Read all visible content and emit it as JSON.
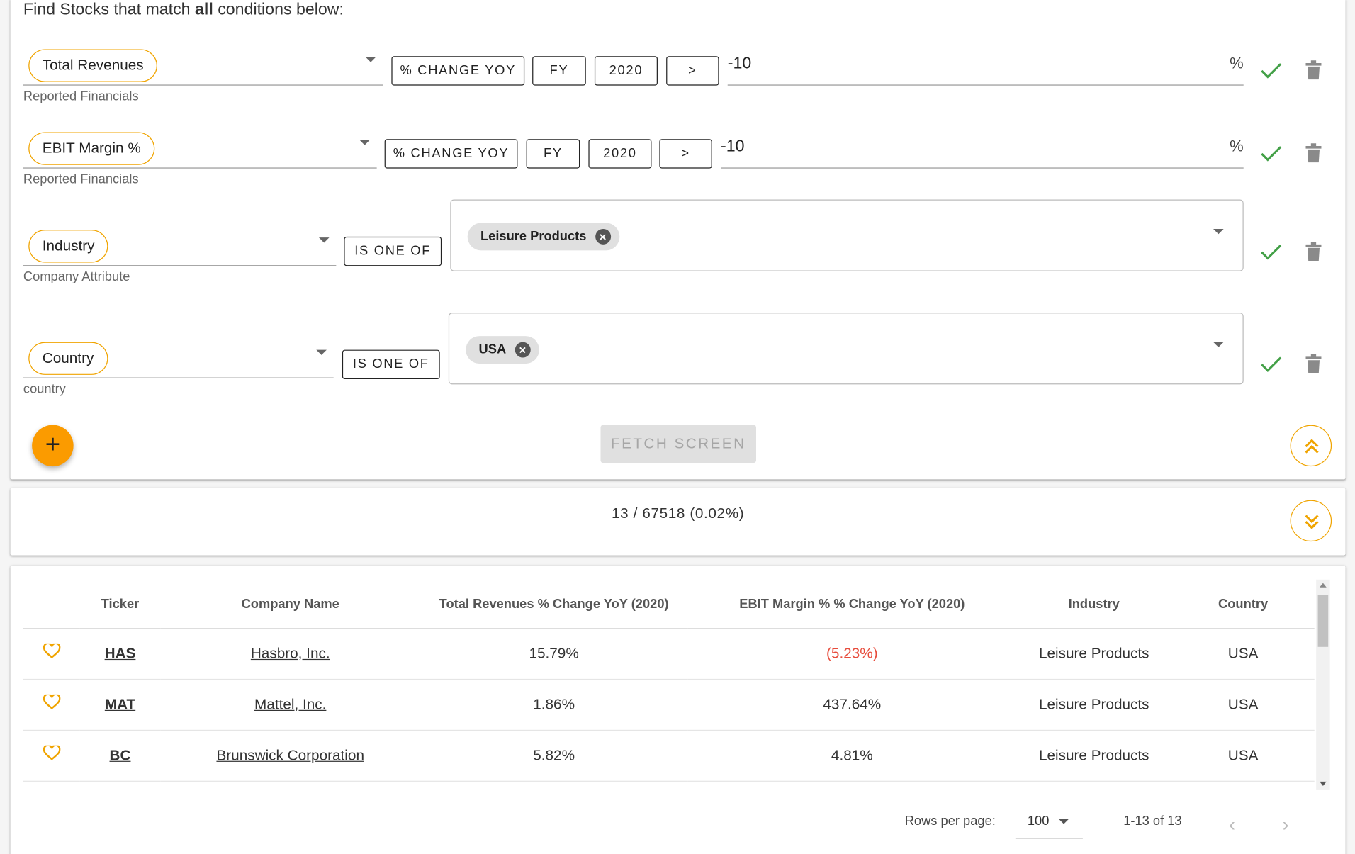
{
  "heading": {
    "prefix": "Find Stocks that match ",
    "bold": "all",
    "suffix": " conditions below:"
  },
  "conditions": [
    {
      "metric": "Total Revenues",
      "source": "Reported Financials",
      "transform": "% CHANGE YOY",
      "period": "FY",
      "year": "2020",
      "operator": ">",
      "value": "-10",
      "unit": "%"
    },
    {
      "metric": "EBIT Margin %",
      "source": "Reported Financials",
      "transform": "% CHANGE YOY",
      "period": "FY",
      "year": "2020",
      "operator": ">",
      "value": "-10",
      "unit": "%"
    },
    {
      "metric": "Industry",
      "source": "Company Attribute",
      "operator": "IS ONE OF",
      "tags": [
        "Leisure Products"
      ]
    },
    {
      "metric": "Country",
      "source": "country",
      "operator": "IS ONE OF",
      "tags": [
        "USA"
      ]
    }
  ],
  "actions": {
    "add_icon": "plus-icon",
    "fetch_label": "FETCH SCREEN",
    "collapse_icon": "double-chevron-up-icon",
    "expand_icon": "double-chevron-down-icon"
  },
  "summary": "13 / 67518 (0.02%)",
  "table": {
    "headers": [
      "",
      "Ticker",
      "Company Name",
      "Total Revenues % Change YoY (2020)",
      "EBIT Margin % % Change YoY (2020)",
      "Industry",
      "Country"
    ],
    "rows": [
      {
        "ticker": "HAS",
        "company": "Hasbro, Inc.",
        "revenue_chg": "15.79%",
        "ebit_chg": "(5.23%)",
        "industry": "Leisure Products",
        "country": "USA"
      },
      {
        "ticker": "MAT",
        "company": "Mattel, Inc.",
        "revenue_chg": "1.86%",
        "ebit_chg": "437.64%",
        "industry": "Leisure Products",
        "country": "USA"
      },
      {
        "ticker": "BC",
        "company": "Brunswick Corporation",
        "revenue_chg": "5.82%",
        "ebit_chg": "4.81%",
        "industry": "Leisure Products",
        "country": "USA"
      }
    ]
  },
  "pagination": {
    "rows_per_page_label": "Rows per page:",
    "rows_per_page": "100",
    "range": "1-13 of 13",
    "prev": "‹",
    "next": "›"
  },
  "colors": {
    "accent": "#fb9b00",
    "check": "#43a047",
    "negative": "#e74c3c"
  }
}
